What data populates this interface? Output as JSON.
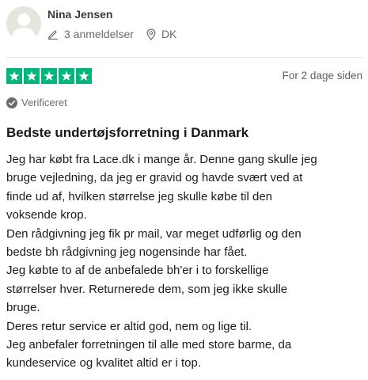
{
  "reviewer": {
    "name": "Nina Jensen",
    "review_count": "3 anmeldelser",
    "country": "DK",
    "avatar_icon": "user-silhouette-icon"
  },
  "rating": {
    "stars": 5,
    "max_stars": 5,
    "color": "#00b67a"
  },
  "date": "For 2 dage siden",
  "verified_label": "Verificeret",
  "title": "Bedste undertøjsforretning i Danmark",
  "body_lines": [
    "Jeg har købt fra Lace.dk i mange år. Denne gang skulle jeg",
    "bruge vejledning, da jeg er gravid og havde svært ved at",
    "finde ud af, hvilken størrelse jeg skulle købe til den",
    "voksende krop.",
    "Den rådgivning jeg fik pr mail, var meget udførlig og den",
    "bedste bh rådgivning jeg nogensinde har fået.",
    "Jeg købte to af de anbefalede bh'er i to forskellige",
    "størrelser hver. Returnerede dem, som jeg ikke skulle",
    "bruge.",
    "Deres retur service er altid god, nem og lige til.",
    "Jeg anbefaler forretningen til alle med store barme, da",
    "kundeservice og kvalitet altid er i top."
  ]
}
